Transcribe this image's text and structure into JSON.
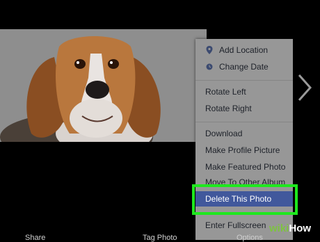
{
  "menu": {
    "items": [
      {
        "label": "Add Location",
        "icon": "location-pin-icon"
      },
      {
        "label": "Change Date",
        "icon": "clock-icon"
      },
      {
        "label": "Rotate Left"
      },
      {
        "label": "Rotate Right"
      },
      {
        "label": "Download"
      },
      {
        "label": "Make Profile Picture"
      },
      {
        "label": "Make Featured Photo"
      },
      {
        "label": "Move To Other Album"
      },
      {
        "label": "Delete This Photo"
      },
      {
        "label": "Enter Fullscreen"
      }
    ]
  },
  "bottom_bar": {
    "share_label": "Share",
    "tag_label": "Tag Photo",
    "options_label": "Options"
  },
  "watermark": {
    "wiki": "wiki",
    "how": "How"
  },
  "colors": {
    "menu_bg": "#979797",
    "active_bg": "#41589c",
    "highlight_border": "#1ee81e"
  }
}
